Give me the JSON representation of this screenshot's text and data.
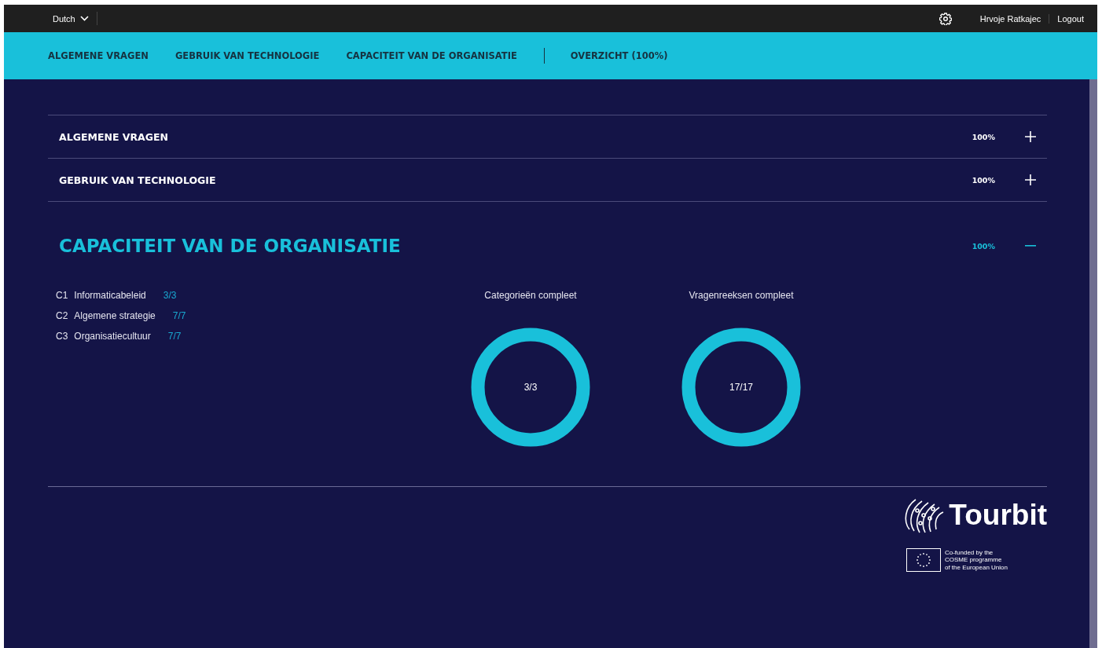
{
  "top_bar": {
    "language": "Dutch",
    "user": "Hrvoje Ratkajec",
    "logout": "Logout"
  },
  "nav": [
    "ALGEMENE VRAGEN",
    "GEBRUIK VAN TECHNOLOGIE",
    "CAPACITEIT VAN DE ORGANISATIE",
    "OVERZICHT (100%)"
  ],
  "sections": [
    {
      "title": "ALGEMENE VRAGEN",
      "percent": "100%",
      "expanded": false
    },
    {
      "title": "GEBRUIK VAN TECHNOLOGIE",
      "percent": "100%",
      "expanded": false
    },
    {
      "title": "CAPACITEIT VAN DE ORGANISATIE",
      "percent": "100%",
      "expanded": true,
      "categories": [
        {
          "code": "C1",
          "name": "Informaticabeleid",
          "score": "3/3"
        },
        {
          "code": "C2",
          "name": "Algemene strategie",
          "score": "7/7"
        },
        {
          "code": "C3",
          "name": "Organisatiecultuur",
          "score": "7/7"
        }
      ],
      "rings": [
        {
          "title": "Categorieën compleet",
          "value": "3/3",
          "level": 1
        },
        {
          "title": "Vragenreeksen compleet",
          "value": "17/17",
          "level": 1
        }
      ]
    }
  ],
  "footer": {
    "logo": "Tourbit",
    "funding": [
      "Co-funded by the",
      "COSME programme",
      "of the European Union"
    ]
  }
}
